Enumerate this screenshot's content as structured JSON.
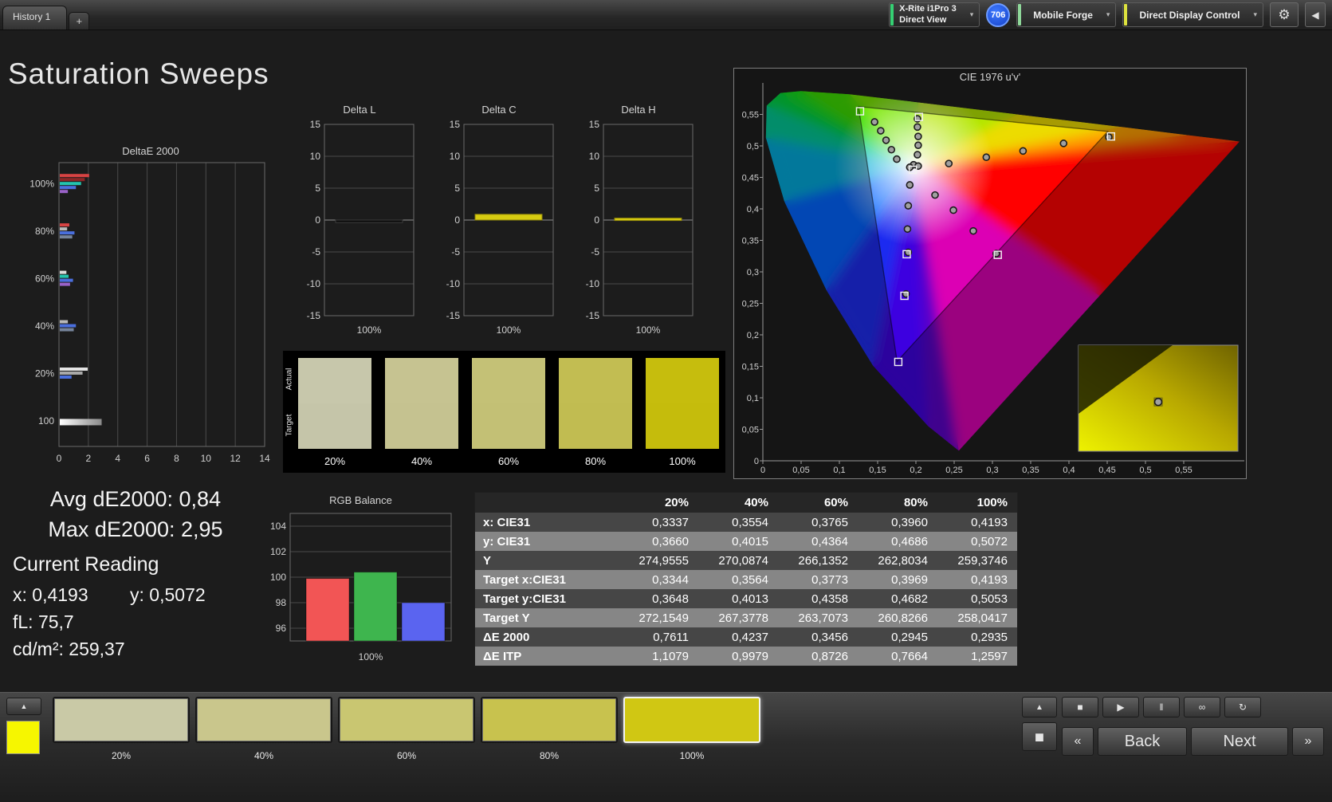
{
  "topbar": {
    "history_tab": "History 1",
    "add_tab": "+",
    "meter_dropdown": {
      "line1": "X-Rite i1Pro 3",
      "line2": "Direct View",
      "accent_color": "#35d073"
    },
    "badge": "706",
    "source_dropdown": {
      "label": "Mobile Forge",
      "accent_color": "#8fd89a"
    },
    "display_dropdown": {
      "label": "Direct Display Control",
      "accent_color": "#dde23e"
    },
    "icons": {
      "gear": "⚙",
      "collapse": "◀",
      "chevron": "▾"
    }
  },
  "page_title": "Saturation Sweeps",
  "summary": {
    "avg_label": "Avg dE2000: 0,84",
    "max_label": "Max dE2000: 2,95",
    "current_reading_title": "Current Reading",
    "x_reading": "x: 0,4193",
    "y_reading": "y: 0,5072",
    "fl_reading": "fL: 75,7",
    "cdm2_reading": "cd/m²: 259,37"
  },
  "swatch_panel": {
    "row_labels": [
      "Actual",
      "Target"
    ],
    "swatches": [
      {
        "label": "20%",
        "actual": "#c7c7ab",
        "target": "#c5c5a9"
      },
      {
        "label": "40%",
        "actual": "#c6c391",
        "target": "#c5c290"
      },
      {
        "label": "60%",
        "actual": "#c4c176",
        "target": "#c3c075"
      },
      {
        "label": "80%",
        "actual": "#c2bd52",
        "target": "#c1bc51"
      },
      {
        "label": "100%",
        "actual": "#c6bd0d",
        "target": "#c5bc0c"
      }
    ]
  },
  "table": {
    "columns": [
      "",
      "20%",
      "40%",
      "60%",
      "80%",
      "100%"
    ],
    "rows": [
      {
        "label": "x: CIE31",
        "values": [
          "0,3337",
          "0,3554",
          "0,3765",
          "0,3960",
          "0,4193"
        ]
      },
      {
        "label": "y: CIE31",
        "values": [
          "0,3660",
          "0,4015",
          "0,4364",
          "0,4686",
          "0,5072"
        ]
      },
      {
        "label": "Y",
        "values": [
          "274,9555",
          "270,0874",
          "266,1352",
          "262,8034",
          "259,3746"
        ]
      },
      {
        "label": "Target x:CIE31",
        "values": [
          "0,3344",
          "0,3564",
          "0,3773",
          "0,3969",
          "0,4193"
        ]
      },
      {
        "label": "Target y:CIE31",
        "values": [
          "0,3648",
          "0,4013",
          "0,4358",
          "0,4682",
          "0,5053"
        ]
      },
      {
        "label": "Target Y",
        "values": [
          "272,1549",
          "267,3778",
          "263,7073",
          "260,8266",
          "258,0417"
        ]
      },
      {
        "label": "ΔE 2000",
        "values": [
          "0,7611",
          "0,4237",
          "0,3456",
          "0,2945",
          "0,2935"
        ]
      },
      {
        "label": "ΔE ITP",
        "values": [
          "1,1079",
          "0,9979",
          "0,8726",
          "0,7664",
          "1,2597"
        ]
      }
    ]
  },
  "bottombar": {
    "up_glyph": "▲",
    "layout_glyph": "◼",
    "mini_swatch_color": "#f6f600",
    "swatches": [
      {
        "label": "20%",
        "color": "#c9c9a6",
        "selected": false
      },
      {
        "label": "40%",
        "color": "#c9c68c",
        "selected": false
      },
      {
        "label": "60%",
        "color": "#c9c671",
        "selected": false
      },
      {
        "label": "80%",
        "color": "#c8c24e",
        "selected": false
      },
      {
        "label": "100%",
        "color": "#d0c713",
        "selected": true
      }
    ],
    "transport": [
      {
        "name": "stop-icon",
        "glyph": "■"
      },
      {
        "name": "play-icon",
        "glyph": "▶"
      },
      {
        "name": "pause-icon",
        "glyph": "‖"
      },
      {
        "name": "continuous-icon",
        "glyph": "∞"
      },
      {
        "name": "refresh-icon",
        "glyph": "↻"
      }
    ],
    "prev_glyph": "«",
    "back_label": "Back",
    "next_label": "Next",
    "more_glyph": "»"
  },
  "chart_data": [
    {
      "id": "deltae2000",
      "type": "bar",
      "title": "DeltaE 2000",
      "orientation": "horizontal",
      "xlim": [
        0,
        14
      ],
      "xticks": [
        0,
        2,
        4,
        6,
        8,
        10,
        12,
        14
      ],
      "groups": [
        {
          "label": "100%",
          "bars": [
            {
              "color": "#d84343",
              "value": 2.0
            },
            {
              "color": "#8e2626",
              "value": 1.7
            },
            {
              "color": "#23c4ae",
              "value": 1.45
            },
            {
              "color": "#4a6fde",
              "value": 1.1
            },
            {
              "color": "#9a62c8",
              "value": 0.55
            }
          ]
        },
        {
          "label": "80%",
          "bars": [
            {
              "color": "#d84343",
              "value": 0.65
            },
            {
              "color": "#b9b9b9",
              "value": 0.5
            },
            {
              "color": "#4a6fde",
              "value": 1.0
            },
            {
              "color": "#76849b",
              "value": 0.85
            }
          ]
        },
        {
          "label": "60%",
          "bars": [
            {
              "color": "#dcdcdc",
              "value": 0.45
            },
            {
              "color": "#23c4ae",
              "value": 0.6
            },
            {
              "color": "#4a6fde",
              "value": 0.9
            },
            {
              "color": "#9a62c8",
              "value": 0.7
            }
          ]
        },
        {
          "label": "40%",
          "bars": [
            {
              "color": "#b9b9b9",
              "value": 0.55
            },
            {
              "color": "#4a6fde",
              "value": 1.1
            },
            {
              "color": "#76849b",
              "value": 0.95
            }
          ]
        },
        {
          "label": "20%",
          "bars": [
            {
              "color": "#e4e4e4",
              "value": 1.9
            },
            {
              "color": "#a9a9a9",
              "value": 1.55
            },
            {
              "color": "#4a6fde",
              "value": 0.8
            }
          ]
        },
        {
          "label": "100",
          "bars": [
            {
              "color": "#ececec",
              "value": 2.85,
              "tall": true
            }
          ]
        }
      ]
    },
    {
      "id": "delta_l",
      "type": "bar",
      "title": "Delta L",
      "ylim": [
        -15,
        15
      ],
      "yticks": [
        15,
        10,
        5,
        0,
        -5,
        -10,
        -15
      ],
      "categories": [
        "100%"
      ],
      "values": [
        -0.4
      ],
      "bar_color": "#0c0c0c",
      "bar_stroke": "#3c3c3c"
    },
    {
      "id": "delta_c",
      "type": "bar",
      "title": "Delta C",
      "ylim": [
        -15,
        15
      ],
      "yticks": [
        15,
        10,
        5,
        0,
        -5,
        -10,
        -15
      ],
      "categories": [
        "100%"
      ],
      "values": [
        0.9
      ],
      "bar_color": "#d7cb11",
      "bar_stroke": "#90870b"
    },
    {
      "id": "delta_h",
      "type": "bar",
      "title": "Delta H",
      "ylim": [
        -15,
        15
      ],
      "yticks": [
        15,
        10,
        5,
        0,
        -5,
        -10,
        -15
      ],
      "categories": [
        "100%"
      ],
      "values": [
        0.3
      ],
      "bar_color": "#d7cb11",
      "bar_stroke": "#90870b"
    },
    {
      "id": "rgb_balance",
      "type": "bar",
      "title": "RGB Balance",
      "categories": [
        "Red",
        "Green",
        "Blue"
      ],
      "values": [
        99.9,
        100.4,
        98.0
      ],
      "colors": [
        "#f25555",
        "#3eb54e",
        "#5a64f0"
      ],
      "ylim": [
        95,
        105
      ],
      "yticks": [
        96,
        98,
        100,
        102,
        104
      ],
      "xlabel": "100%"
    },
    {
      "id": "cie",
      "type": "scatter",
      "title": "CIE 1976 u'v'",
      "xlim": [
        0,
        0.62
      ],
      "ylim": [
        0,
        0.62
      ],
      "axis_ticks": [
        0,
        0.05,
        0.1,
        0.15,
        0.2,
        0.25,
        0.3,
        0.35,
        0.4,
        0.45,
        0.5,
        0.55
      ],
      "white_point": [
        0.198,
        0.468
      ],
      "srgb_triangle": [
        [
          0.4507,
          0.5229
        ],
        [
          0.125,
          0.5625
        ],
        [
          0.1754,
          0.1579
        ]
      ],
      "measured_points": [
        [
          0.146,
          0.538
        ],
        [
          0.154,
          0.524
        ],
        [
          0.161,
          0.509
        ],
        [
          0.168,
          0.494
        ],
        [
          0.175,
          0.479
        ],
        [
          0.202,
          0.543
        ],
        [
          0.202,
          0.53
        ],
        [
          0.203,
          0.515
        ],
        [
          0.203,
          0.501
        ],
        [
          0.202,
          0.486
        ],
        [
          0.197,
          0.47
        ],
        [
          0.192,
          0.466
        ],
        [
          0.203,
          0.468
        ],
        [
          0.243,
          0.472
        ],
        [
          0.292,
          0.482
        ],
        [
          0.34,
          0.492
        ],
        [
          0.393,
          0.504
        ],
        [
          0.452,
          0.514
        ],
        [
          0.192,
          0.438
        ],
        [
          0.19,
          0.405
        ],
        [
          0.189,
          0.368
        ],
        [
          0.19,
          0.331
        ],
        [
          0.187,
          0.265
        ],
        [
          0.225,
          0.422
        ],
        [
          0.249,
          0.398
        ],
        [
          0.275,
          0.365
        ],
        [
          0.305,
          0.329
        ]
      ],
      "target_points": [
        [
          0.127,
          0.555
        ],
        [
          0.204,
          0.546
        ],
        [
          0.455,
          0.515
        ],
        [
          0.196,
          0.462
        ],
        [
          0.188,
          0.328
        ],
        [
          0.185,
          0.262
        ],
        [
          0.177,
          0.157
        ],
        [
          0.307,
          0.327
        ]
      ],
      "inset_marker": [
        0.5,
        0.465
      ]
    }
  ]
}
